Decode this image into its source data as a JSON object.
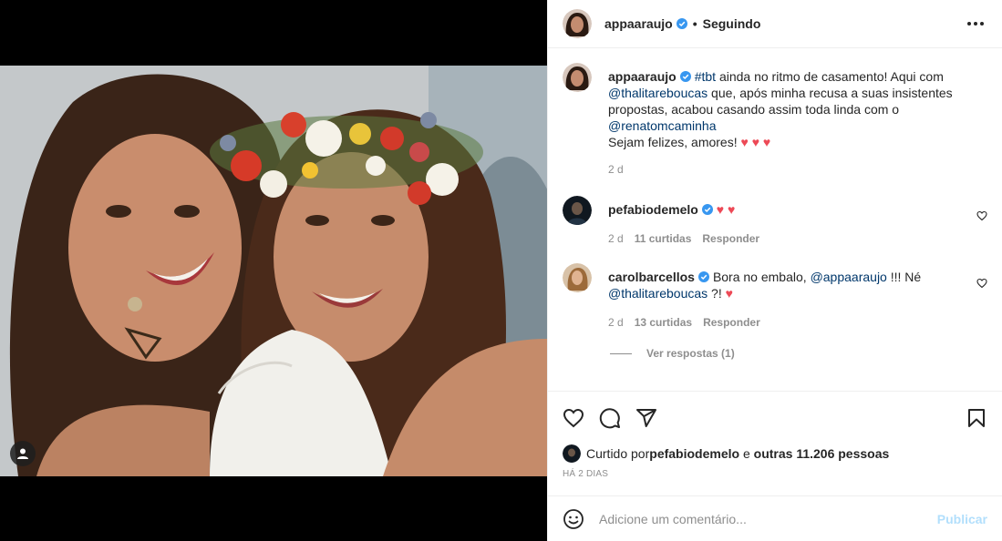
{
  "author": {
    "username": "appaaraujo",
    "separator": "•",
    "follow_status": "Seguindo"
  },
  "caption": {
    "hashtag": "#tbt",
    "text1": " ainda no ritmo de casamento! Aqui com ",
    "mention1": "@thalitareboucas",
    "text2": " que, após minha recusa a suas insistentes propostas, acabou casando assim toda linda com o ",
    "mention2": "@renatomcaminha",
    "line2": "Sejam felizes, amores! ",
    "hearts": "♥ ♥ ♥",
    "time": "2 d"
  },
  "comments": [
    {
      "username": "pefabiodemelo",
      "hearts": "♥ ♥",
      "time": "2 d",
      "likes": "11 curtidas",
      "reply": "Responder"
    },
    {
      "username": "carolbarcellos",
      "text1": "Bora no embalo, ",
      "mention1": "@appaaraujo",
      "text2": " !!! Né ",
      "mention2": "@thalitareboucas",
      "text3": " ?! ",
      "hearts": "♥",
      "time": "2 d",
      "likes": "13 curtidas",
      "reply": "Responder",
      "view_replies": "Ver respostas (1)"
    }
  ],
  "likes": {
    "prefix": "Curtido por ",
    "user": "pefabiodemelo",
    "middle": " e ",
    "others": "outras 11.206 pessoas"
  },
  "timestamp": "HÁ 2 DIAS",
  "add_comment": {
    "placeholder": "Adicione um comentário...",
    "publish_label": "Publicar"
  },
  "colors": {
    "link": "#00376b",
    "heart": "#ed4956",
    "verified": "#3897f0",
    "publish_disabled": "#b2dffc",
    "secondary_text": "#8e8e8e"
  },
  "icons": [
    "verified-badge-icon",
    "more-options-icon",
    "heart-icon",
    "comment-icon",
    "share-icon",
    "bookmark-icon",
    "emoji-icon",
    "user-tag-icon"
  ]
}
